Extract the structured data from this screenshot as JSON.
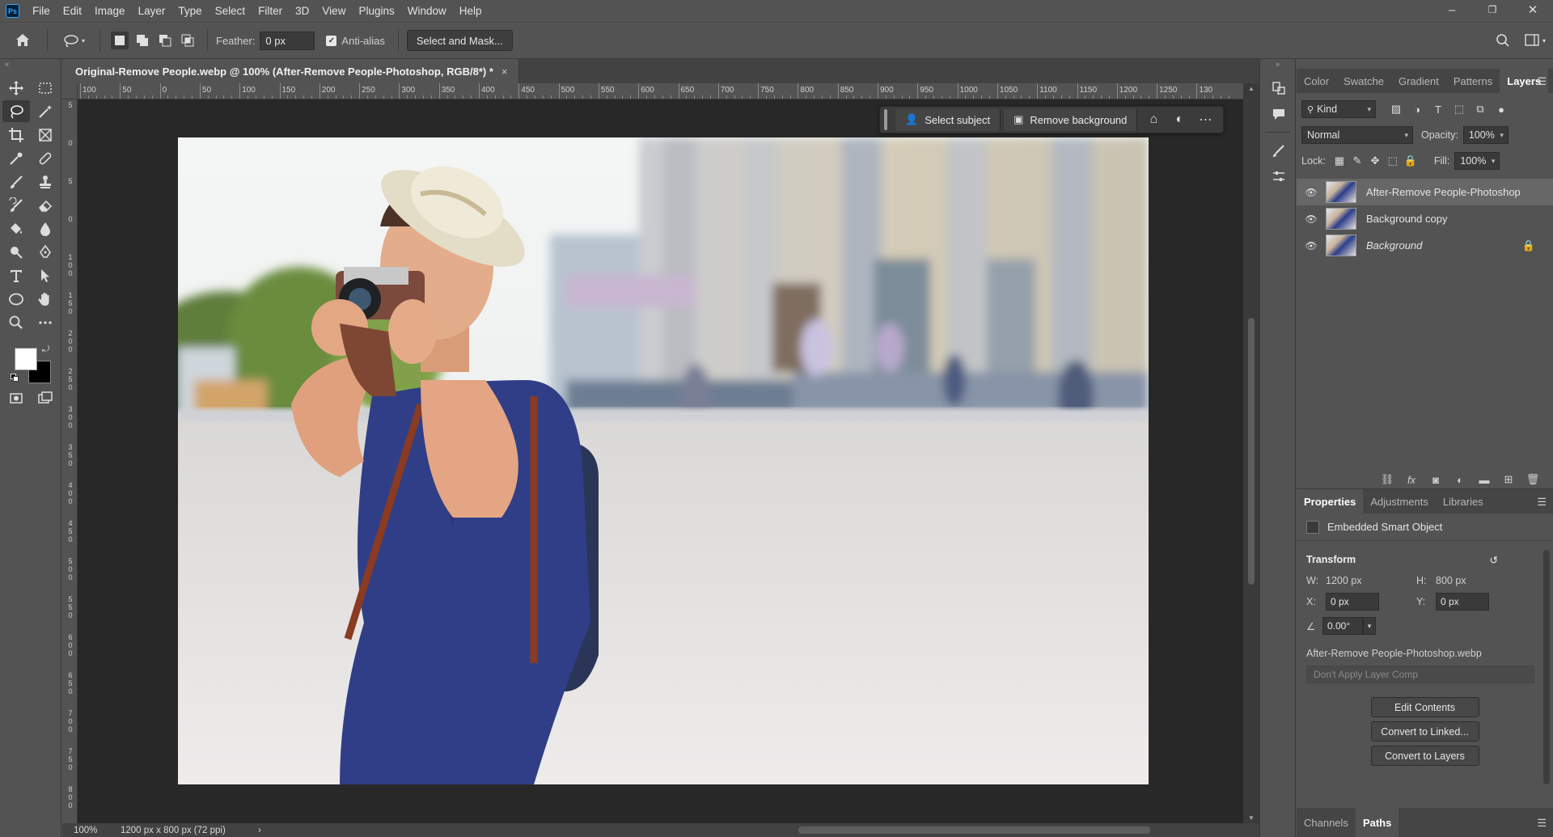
{
  "app": {
    "logo": "Ps",
    "menu": [
      "File",
      "Edit",
      "Image",
      "Layer",
      "Type",
      "Select",
      "Filter",
      "3D",
      "View",
      "Plugins",
      "Window",
      "Help"
    ],
    "window_controls": [
      "–",
      "❐",
      "✕"
    ]
  },
  "options_bar": {
    "feather_label": "Feather:",
    "feather_value": "0 px",
    "antialias_label": "Anti-alias",
    "select_mask_label": "Select and Mask..."
  },
  "document": {
    "tab_title": "Original-Remove People.webp @ 100% (After-Remove People-Photoshop, RGB/8*) *",
    "tab_close": "×",
    "ruler_top": [
      "100",
      "50",
      "0",
      "50",
      "100",
      "150",
      "200",
      "250",
      "300",
      "350",
      "400",
      "450",
      "500",
      "550",
      "600",
      "650",
      "700",
      "750",
      "800",
      "850",
      "900",
      "950",
      "1000",
      "1050",
      "1100",
      "1150",
      "1200",
      "1250",
      "130"
    ],
    "ruler_left": [
      "5",
      "0",
      "5",
      "0",
      "1 0 0",
      "1 5 0",
      "2 0 0",
      "2 5 0",
      "3 0 0",
      "3 5 0",
      "4 0 0",
      "4 5 0",
      "5 0 0",
      "5 5 0",
      "6 0 0",
      "6 5 0",
      "7 0 0",
      "7 5 0",
      "8 0 0"
    ]
  },
  "contextual_bar": {
    "select_subject": "Select subject",
    "remove_background": "Remove background"
  },
  "status": {
    "zoom": "100%",
    "doc_size": "1200 px x 800 px (72 ppi)",
    "arrow": "›"
  },
  "layers_panel": {
    "tabs": [
      "Color",
      "Swatche",
      "Gradient",
      "Patterns",
      "Layers"
    ],
    "active_tab": "Layers",
    "filter_kind": "Kind",
    "blend_mode": "Normal",
    "opacity_label": "Opacity:",
    "opacity_value": "100%",
    "lock_label": "Lock:",
    "fill_label": "Fill:",
    "fill_value": "100%",
    "layers": [
      {
        "name": "After-Remove People-Photoshop",
        "selected": true
      },
      {
        "name": "Background copy",
        "selected": false
      },
      {
        "name": "Background",
        "selected": false,
        "locked": true
      }
    ]
  },
  "properties_panel": {
    "tabs": [
      "Properties",
      "Adjustments",
      "Libraries"
    ],
    "active_tab": "Properties",
    "type": "Embedded Smart Object",
    "transform_label": "Transform",
    "w_label": "W:",
    "w_value": "1200 px",
    "h_label": "H:",
    "h_value": "800 px",
    "x_label": "X:",
    "x_value": "0 px",
    "y_label": "Y:",
    "y_value": "0 px",
    "angle_value": "0.00°",
    "filename": "After-Remove People-Photoshop.webp",
    "layer_comp_placeholder": "Don't Apply Layer Comp",
    "buttons": [
      "Edit Contents",
      "Convert to Linked...",
      "Convert to Layers"
    ]
  },
  "bottom_tabs": [
    "Channels",
    "Paths"
  ],
  "bottom_active": "Paths",
  "colors": {
    "foreground": "#ffffff",
    "background": "#000000",
    "ui_bg": "#535353",
    "canvas_bg": "#282828"
  }
}
